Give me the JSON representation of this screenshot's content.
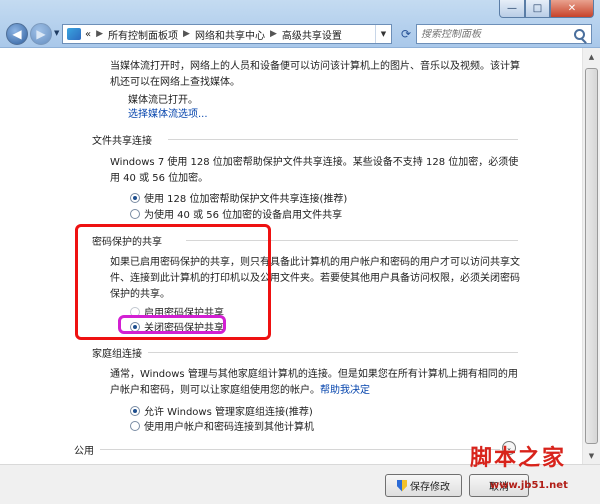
{
  "window": {
    "minimize": "—",
    "maximize": "□",
    "close": "✕"
  },
  "nav": {
    "back": "◀",
    "forward": "▶",
    "history_dropdown": "▼"
  },
  "address": {
    "overflow": "«",
    "crumbs": [
      "所有控制面板项",
      "网络和共享中心",
      "高级共享设置"
    ],
    "separator": "▶",
    "dropdown": "▼",
    "refresh": "⟳"
  },
  "search": {
    "placeholder": "搜索控制面板"
  },
  "media": {
    "intro": "当媒体流打开时，网络上的人员和设备便可以访问该计算机上的图片、音乐以及视频。该计算机还可以在网络上查找媒体。",
    "status": "媒体流已打开。",
    "link": "选择媒体流选项..."
  },
  "file_sharing": {
    "title": "文件共享连接",
    "desc": "Windows 7 使用 128 位加密帮助保护文件共享连接。某些设备不支持 128 位加密，必须使用 40 或 56 位加密。",
    "option1": "使用 128 位加密帮助保护文件共享连接(推荐)",
    "option2": "为使用 40 或 56 位加密的设备启用文件共享"
  },
  "password_sharing": {
    "title": "密码保护的共享",
    "desc": "如果已启用密码保护的共享，则只有具备此计算机的用户帐户和密码的用户才可以访问共享文件、连接到此计算机的打印机以及公用文件夹。若要使其他用户具备访问权限，必须关闭密码保护的共享。",
    "option_on": "启用密码保护共享",
    "option_off": "关闭密码保护共享"
  },
  "homegroup": {
    "title": "家庭组连接",
    "desc": "通常，Windows 管理与其他家庭组计算机的连接。但是如果您在所有计算机上拥有相同的用户帐户和密码，则可以让家庭组使用您的帐户。",
    "help_link": "帮助我决定",
    "option1": "允许 Windows 管理家庭组连接(推荐)",
    "option2": "使用用户帐户和密码连接到其他计算机"
  },
  "public": {
    "title": "公用",
    "expand": "⌄"
  },
  "scroll": {
    "up": "▲",
    "down": "▼"
  },
  "footer": {
    "save": "保存修改",
    "cancel": "取消"
  },
  "watermark": {
    "title": "脚本之家",
    "url": "www.jb51.net"
  }
}
